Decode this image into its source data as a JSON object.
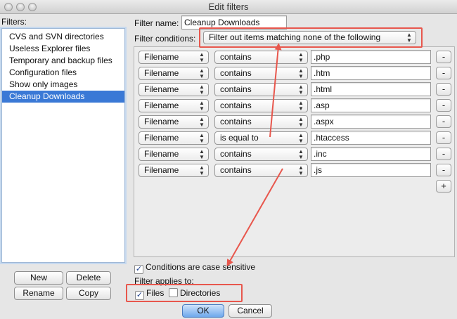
{
  "window": {
    "title": "Edit filters"
  },
  "sidebar": {
    "label": "Filters:",
    "items": [
      {
        "label": "CVS and SVN directories"
      },
      {
        "label": "Useless Explorer files"
      },
      {
        "label": "Temporary and backup files"
      },
      {
        "label": "Configuration files"
      },
      {
        "label": "Show only images"
      },
      {
        "label": "Cleanup Downloads",
        "selected": true
      }
    ],
    "buttons": {
      "new": "New",
      "delete": "Delete",
      "rename": "Rename",
      "copy": "Copy"
    }
  },
  "filter": {
    "name_label": "Filter name:",
    "name_value": "Cleanup Downloads",
    "conditions_label": "Filter conditions:",
    "conditions_value": "Filter out items matching none of the following"
  },
  "conditions": [
    {
      "field": "Filename",
      "op": "contains",
      "value": ".php"
    },
    {
      "field": "Filename",
      "op": "contains",
      "value": ".htm"
    },
    {
      "field": "Filename",
      "op": "contains",
      "value": ".html"
    },
    {
      "field": "Filename",
      "op": "contains",
      "value": ".asp"
    },
    {
      "field": "Filename",
      "op": "contains",
      "value": ".aspx"
    },
    {
      "field": "Filename",
      "op": "is equal to",
      "value": ".htaccess"
    },
    {
      "field": "Filename",
      "op": "contains",
      "value": ".inc"
    },
    {
      "field": "Filename",
      "op": "contains",
      "value": ".js"
    }
  ],
  "row_buttons": {
    "remove": "-",
    "add": "+"
  },
  "options": {
    "case_sensitive_label": "Conditions are case sensitive",
    "case_sensitive": true,
    "applies_to_label": "Filter applies to:",
    "files_label": "Files",
    "files": true,
    "directories_label": "Directories",
    "directories": false
  },
  "footer": {
    "ok": "OK",
    "cancel": "Cancel"
  },
  "colors": {
    "selection": "#3a79d6",
    "annotation": "#e8574d",
    "default_button": "#6ea8ec"
  },
  "icons": {
    "popup": "up-down-arrows-icon",
    "check": "checkmark-icon"
  }
}
